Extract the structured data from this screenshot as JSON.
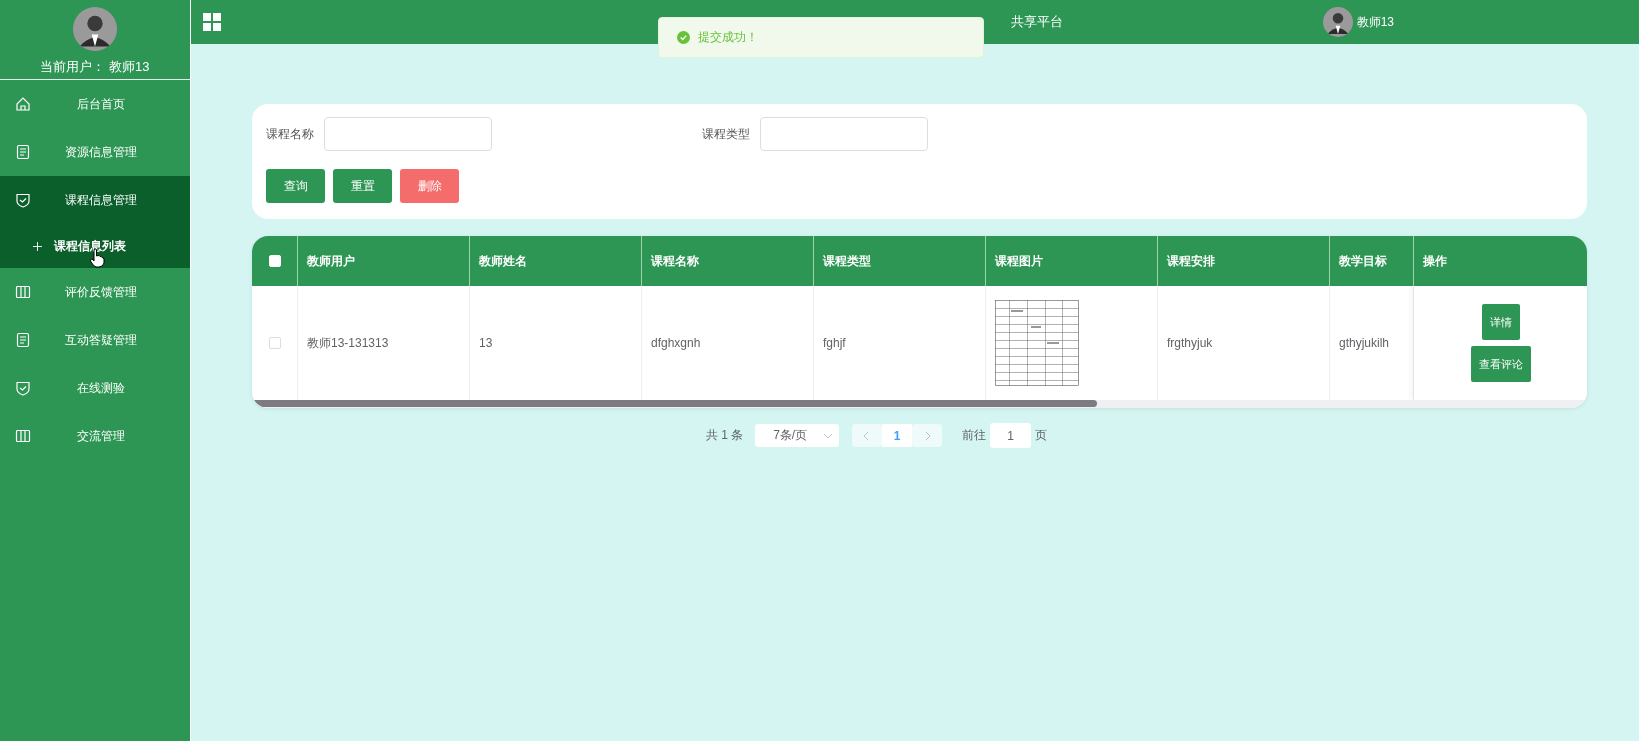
{
  "sidebar": {
    "current_user": "当前用户： 教师13",
    "items": [
      {
        "label": "后台首页",
        "kind": "home",
        "selected": false,
        "expanded": false
      },
      {
        "label": "资源信息管理",
        "kind": "document",
        "selected": false,
        "expanded": false
      },
      {
        "label": "课程信息管理",
        "kind": "shield",
        "selected": false,
        "expanded": true,
        "children": [
          {
            "label": "课程信息列表",
            "selected": true
          }
        ]
      },
      {
        "label": "评价反馈管理",
        "kind": "columns",
        "selected": false,
        "expanded": false
      },
      {
        "label": "互动答疑管理",
        "kind": "document",
        "selected": false,
        "expanded": false
      },
      {
        "label": "在线测验",
        "kind": "shield",
        "selected": false,
        "expanded": false
      },
      {
        "label": "交流管理",
        "kind": "columns",
        "selected": false,
        "expanded": false
      }
    ]
  },
  "header": {
    "title": "共享平台",
    "user": "教师13"
  },
  "toast": {
    "kind": "success",
    "text": "提交成功！"
  },
  "search": {
    "fields": [
      {
        "label": "课程名称"
      },
      {
        "label": "课程类型"
      }
    ],
    "buttons": [
      {
        "label": "查询",
        "kind": "primary"
      },
      {
        "label": "重置",
        "kind": "primary"
      },
      {
        "label": "删除",
        "kind": "danger"
      }
    ]
  },
  "table": {
    "all_selected": false,
    "columns": [
      "教师用户",
      "教师姓名",
      "课程名称",
      "课程类型",
      "课程图片",
      "课程安排",
      "教学目标",
      "操作"
    ],
    "rows": [
      {
        "selected": false,
        "cells": [
          {
            "kind": "text",
            "text": "教师13-131313"
          },
          {
            "kind": "text",
            "text": "13"
          },
          {
            "kind": "text",
            "text": "dfghxgnh"
          },
          {
            "kind": "text",
            "text": "fghjf"
          },
          {
            "kind": "picture"
          },
          {
            "kind": "text",
            "text": "frgthyjuk"
          },
          {
            "kind": "text",
            "text": "gthyjukilh"
          }
        ],
        "actions": [
          "详情",
          "查看评论"
        ]
      }
    ]
  },
  "pagination": {
    "total": "共 1 条",
    "page_size": "7条/页",
    "pages": [
      {
        "label": "1",
        "selected": true
      }
    ],
    "goto_label": "前往",
    "goto_value": "1",
    "suffix": "页"
  }
}
